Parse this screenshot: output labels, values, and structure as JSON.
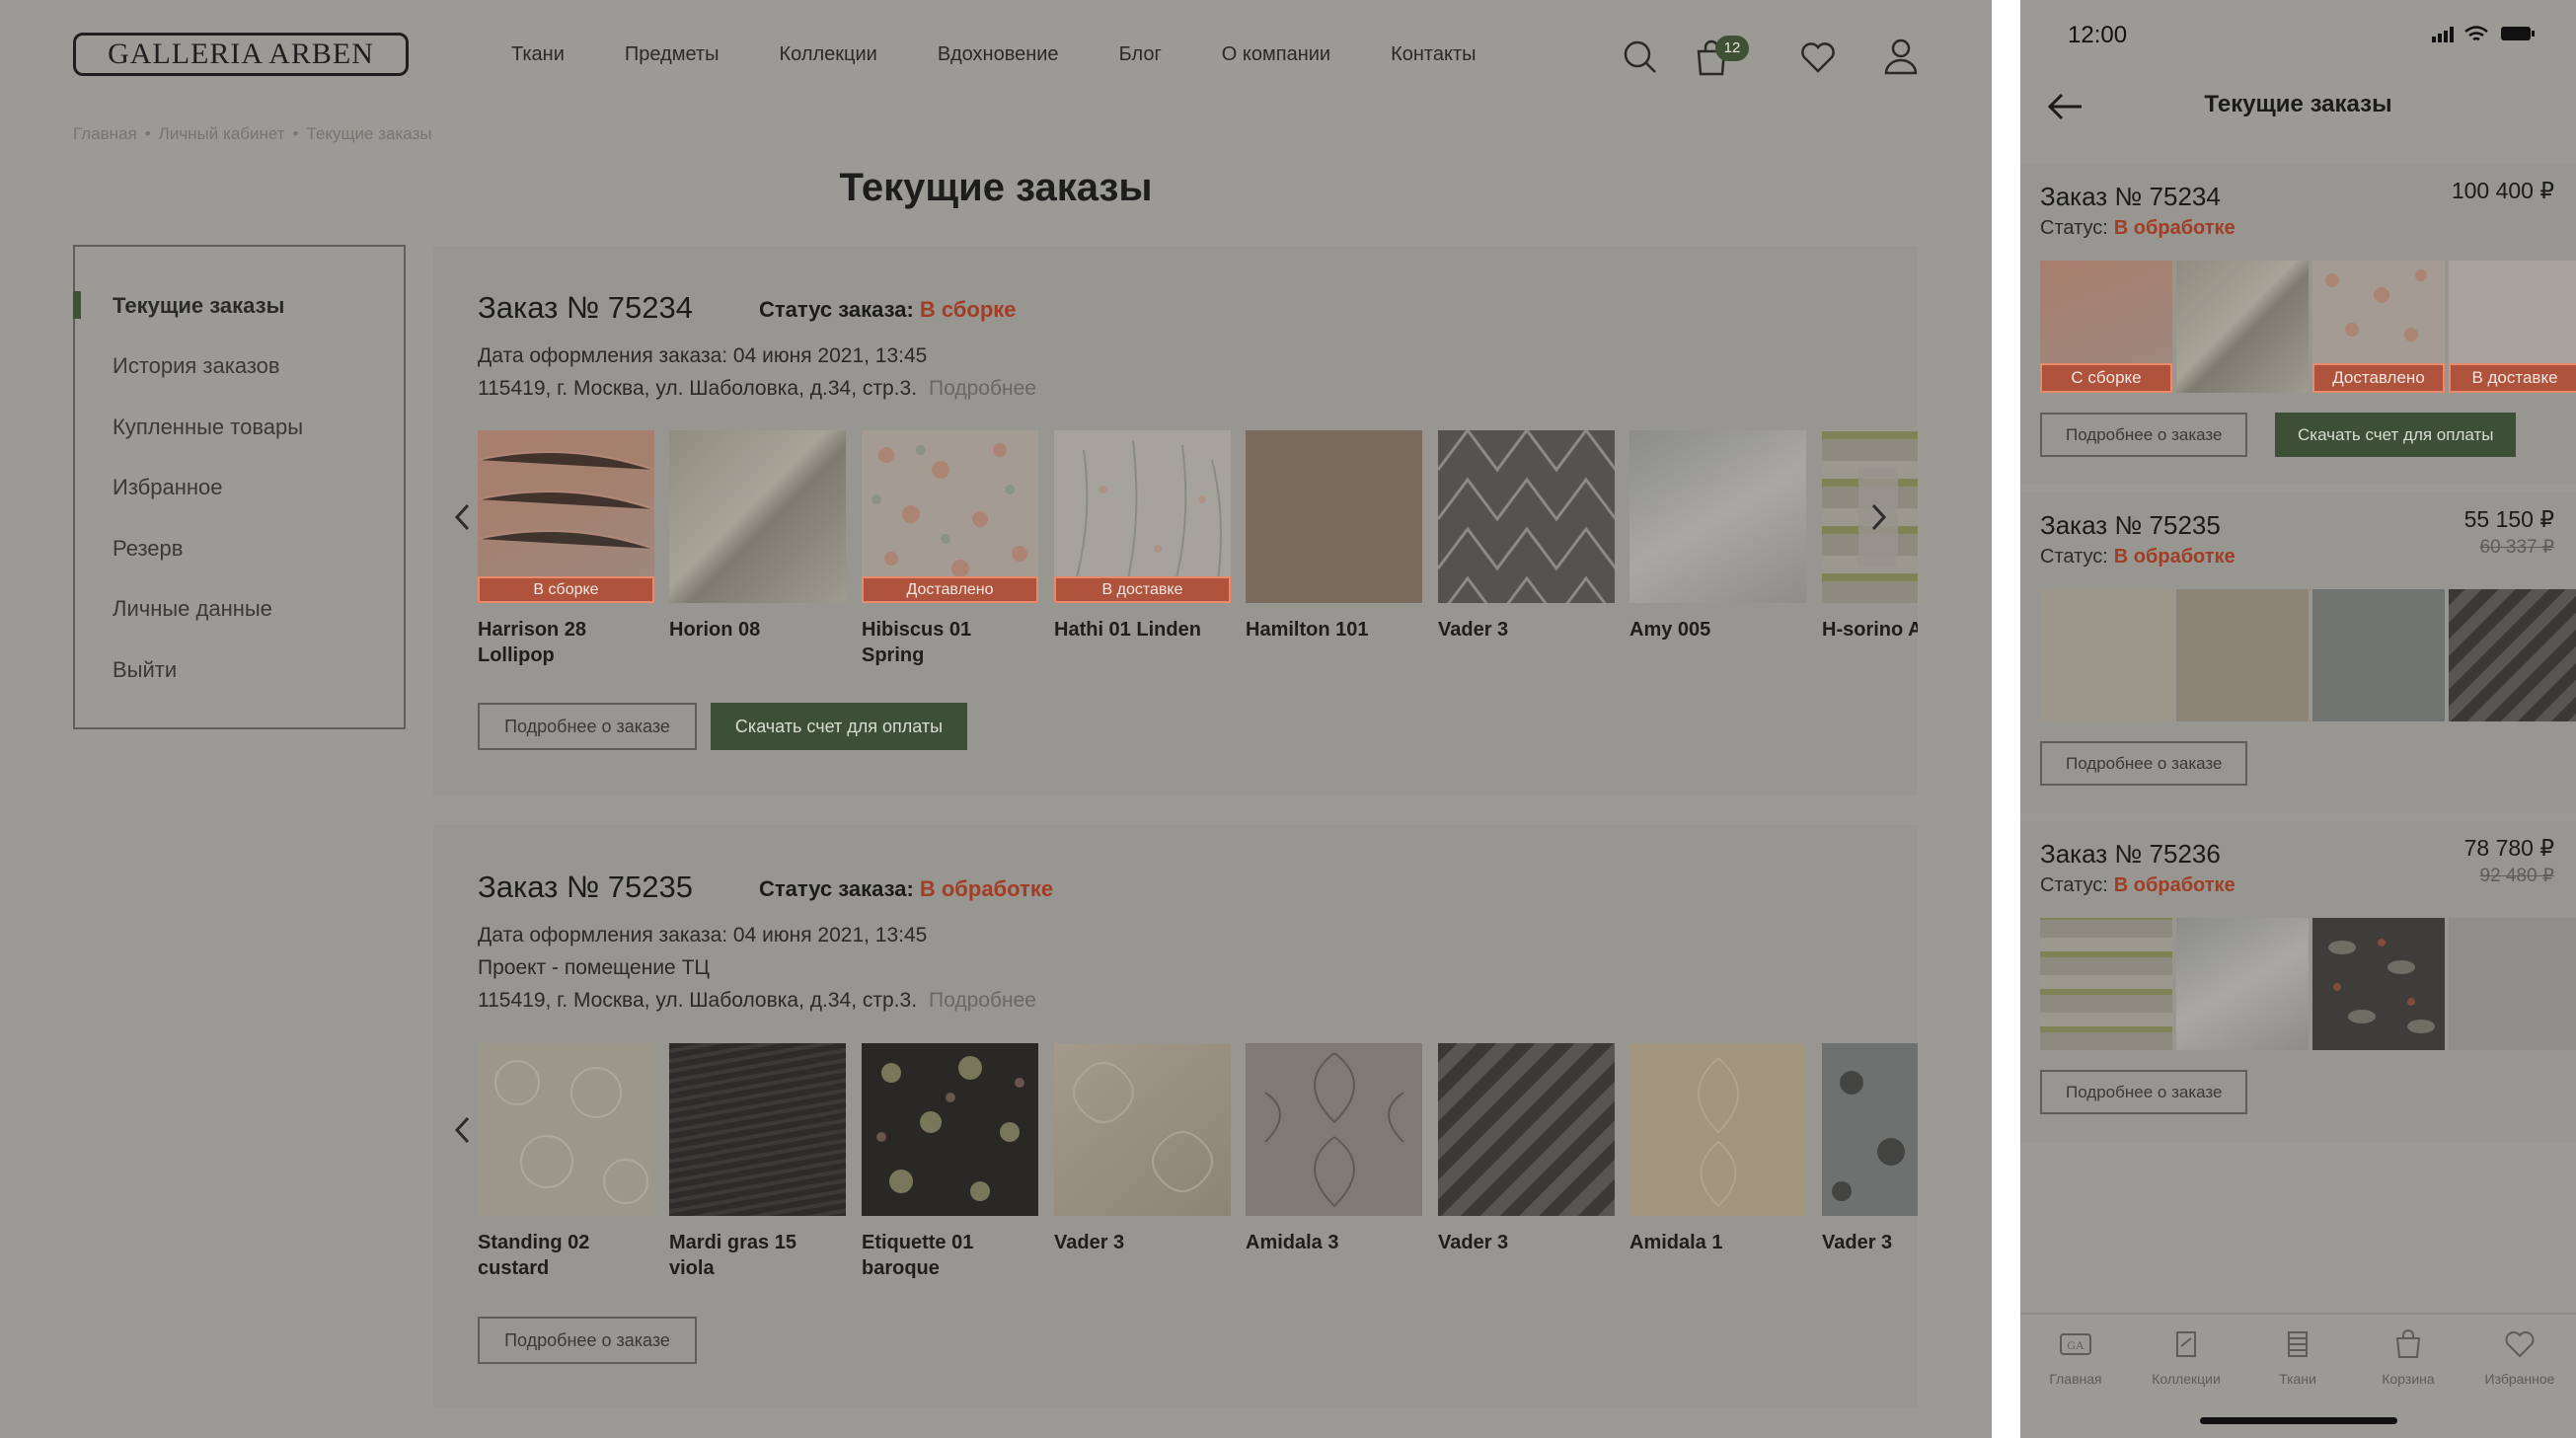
{
  "desktop": {
    "logo": "GALLERIA ARBEN",
    "nav": [
      "Ткани",
      "Предметы",
      "Коллекции",
      "Вдохновение",
      "Блог",
      "О компании",
      "Контакты"
    ],
    "cart_count": "12",
    "breadcrumb": [
      "Главная",
      "Личный кабинет",
      "Текущие заказы"
    ],
    "breadcrumb_sep": "•",
    "page_title": "Текущие заказы",
    "sidebar": [
      "Текущие заказы",
      "История заказов",
      "Купленные товары",
      "Избранное",
      "Резерв",
      "Личные данные",
      "Выйти"
    ],
    "orders": [
      {
        "title": "Заказ № 75234",
        "status_label": "Статус заказа:",
        "status": "В сборке",
        "date_line": "Дата оформления заказа: 04 июня 2021, 13:45",
        "address": "115419, г. Москва, ул. Шаболовка, д.34, стр.3.",
        "more": "Подробнее",
        "items": [
          {
            "name": "Harrison 28 Lollipop",
            "badge": "В сборке"
          },
          {
            "name": "Horion 08",
            "badge": ""
          },
          {
            "name": "Hibiscus 01 Spring",
            "badge": "Доставлено"
          },
          {
            "name": "Hathi 01 Linden",
            "badge": "В доставке"
          },
          {
            "name": "Hamilton 101",
            "badge": ""
          },
          {
            "name": "Vader 3",
            "badge": ""
          },
          {
            "name": "Amy 005",
            "badge": ""
          },
          {
            "name": "H-sorino A Jade",
            "badge": ""
          }
        ],
        "btn_details": "Подробнее о заказе",
        "btn_invoice": "Скачать счет для оплаты"
      },
      {
        "title": "Заказ № 75235",
        "status_label": "Статус заказа:",
        "status": "В обработке",
        "date_line": "Дата оформления заказа: 04 июня 2021, 13:45",
        "project_line": "Проект - помещение ТЦ",
        "address": "115419, г. Москва, ул. Шаболовка, д.34, стр.3.",
        "more": "Подробнее",
        "items": [
          {
            "name": "Standing 02 custard"
          },
          {
            "name": "Mardi gras 15 viola"
          },
          {
            "name": "Etiquette 01 baroque"
          },
          {
            "name": "Vader 3"
          },
          {
            "name": "Amidala 3"
          },
          {
            "name": "Vader 3"
          },
          {
            "name": "Amidala 1"
          },
          {
            "name": "Vader 3"
          }
        ],
        "btn_details": "Подробнее о заказе"
      }
    ]
  },
  "mobile": {
    "time": "12:00",
    "title": "Текущие заказы",
    "status_label": "Статус:",
    "orders": [
      {
        "title": "Заказ № 75234",
        "price": "100 400 ₽",
        "old_price": "",
        "status": "В обработке",
        "badges": [
          "С сборке",
          "",
          "Доставлено",
          "В доставке"
        ],
        "btn_details": "Подробнее о заказе",
        "btn_invoice": "Скачать счет для оплаты"
      },
      {
        "title": "Заказ № 75235",
        "price": "55 150 ₽",
        "old_price": "60 337 ₽",
        "status": "В обработке",
        "btn_details": "Подробнее о заказе"
      },
      {
        "title": "Заказ № 75236",
        "price": "78 780 ₽",
        "old_price": "92 480 ₽",
        "status": "В обработке",
        "btn_details": "Подробнее о заказе"
      }
    ],
    "tabs": [
      {
        "label": "Главная",
        "icon": "ga-logo-icon"
      },
      {
        "label": "Коллекции",
        "icon": "collections-icon"
      },
      {
        "label": "Ткани",
        "icon": "fabrics-icon"
      },
      {
        "label": "Корзина",
        "icon": "cart-icon"
      },
      {
        "label": "Избранное",
        "icon": "heart-icon"
      }
    ]
  },
  "colors": {
    "overlay_bg": "#9c9a94",
    "accent_green": "#3d4f36",
    "status_red": "#a23d25",
    "badge_orange": "#b0533d"
  }
}
